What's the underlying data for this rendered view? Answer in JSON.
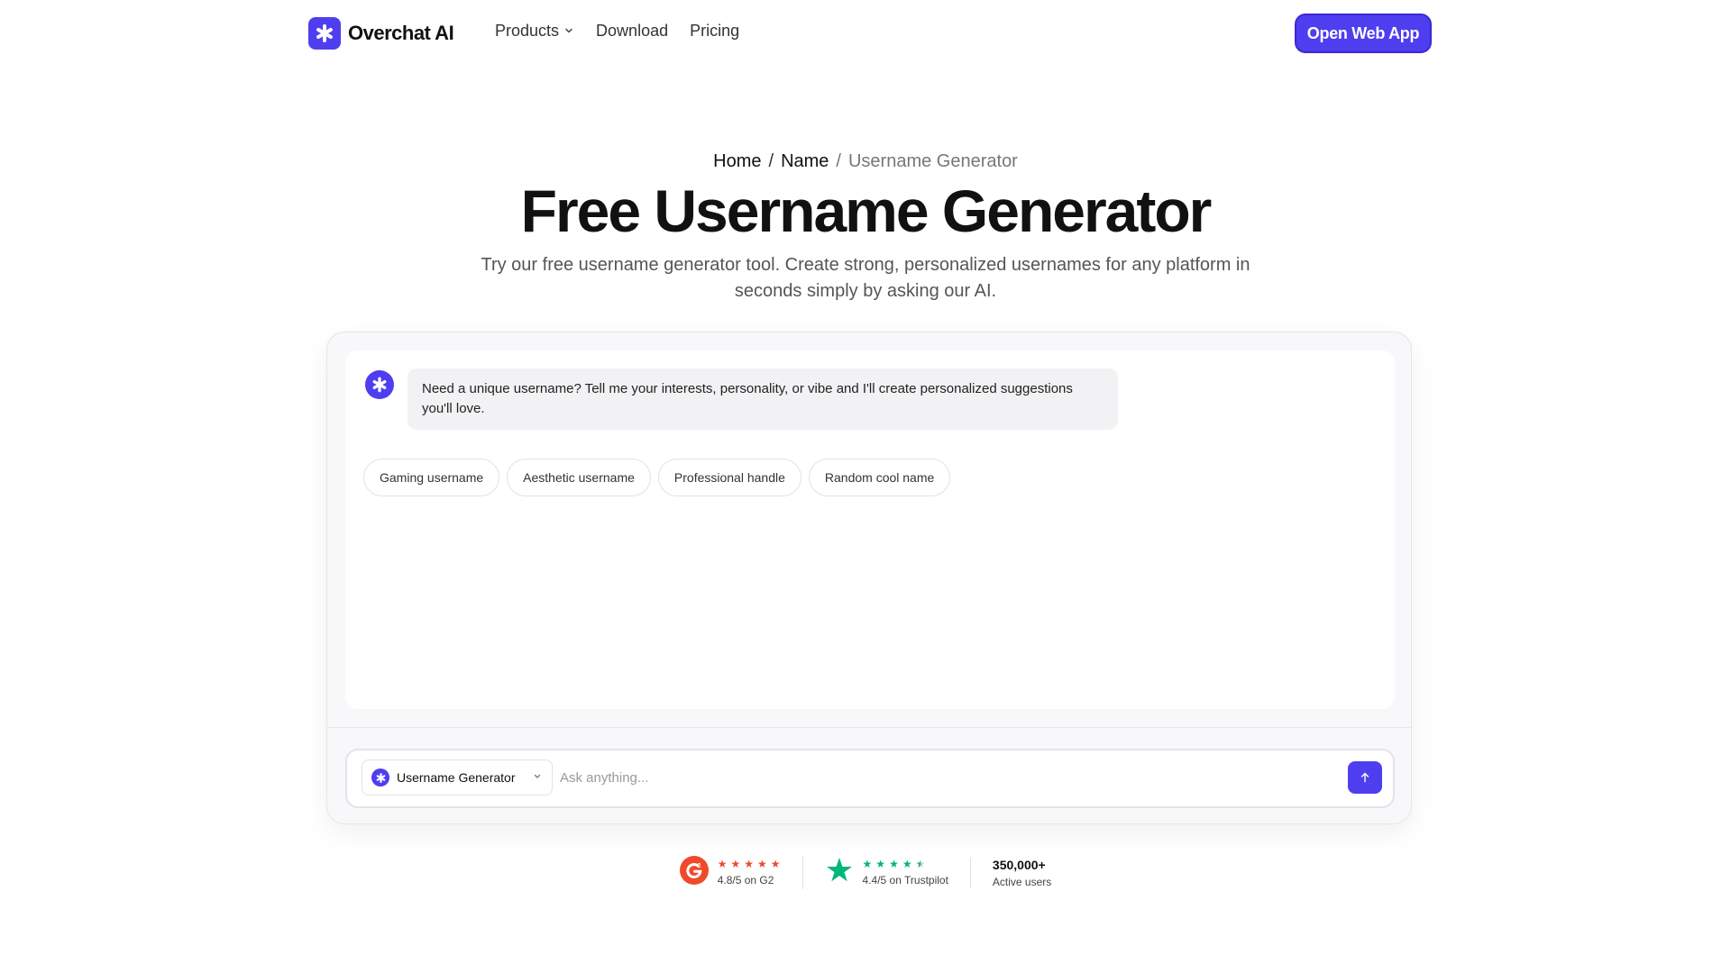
{
  "header": {
    "brand": "Overchat AI",
    "nav": [
      {
        "label": "Products",
        "has_dropdown": true
      },
      {
        "label": "Download"
      },
      {
        "label": "Pricing"
      }
    ],
    "cta": "Open Web App"
  },
  "hero": {
    "breadcrumb": [
      "Home",
      "Name",
      "Username Generator"
    ],
    "title": "Free Username Generator",
    "subtitle": "Try our free username generator tool. Create strong, personalized usernames for any platform in seconds simply by asking our AI."
  },
  "chat": {
    "assistant_message": "Need a unique username? Tell me your interests, personality, or vibe and I'll create personalized suggestions you'll love.",
    "suggestions": [
      "Gaming username",
      "Aesthetic username",
      "Professional handle",
      "Random cool name"
    ],
    "tool_selected": "Username Generator",
    "input_placeholder": "Ask anything..."
  },
  "ratings": {
    "g2": {
      "score": 4.8,
      "label": "4.8/5 on G2",
      "color": "#ef4a2b"
    },
    "trustpilot": {
      "score": 4.4,
      "label": "4.4/5 on Trustpilot",
      "color": "#00b67a"
    },
    "users": {
      "count": "350,000+",
      "label": "Active users"
    }
  },
  "colors": {
    "brand": "#4f3ef0"
  }
}
